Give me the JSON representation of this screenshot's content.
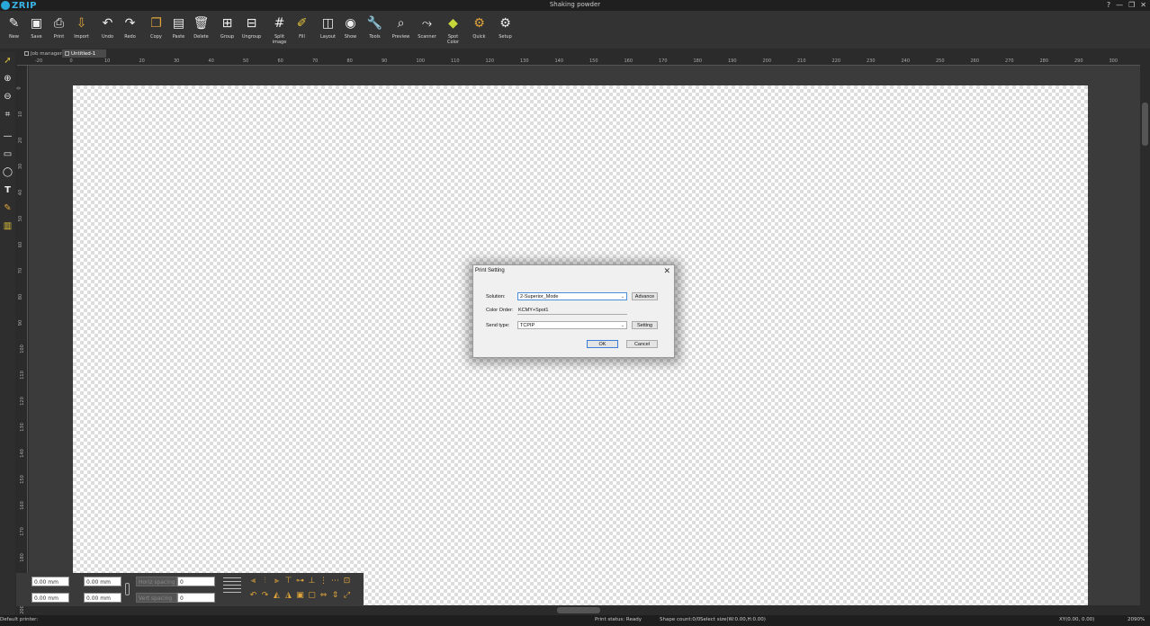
{
  "app": {
    "logo_text": "ZRIP",
    "window_title": "Shaking powder",
    "controls": [
      "?",
      "—",
      "❐",
      "✕"
    ]
  },
  "toolbar": {
    "buttons": [
      {
        "label": "New",
        "icon": "new-icon"
      },
      {
        "label": "Save",
        "icon": "save-icon"
      },
      {
        "label": "Print",
        "icon": "print-icon"
      },
      {
        "label": "Import",
        "icon": "import-icon"
      },
      {
        "label": "Undo",
        "icon": "undo-icon"
      },
      {
        "label": "Redo",
        "icon": "redo-icon"
      },
      {
        "label": "Copy",
        "icon": "copy-icon"
      },
      {
        "label": "Paste",
        "icon": "paste-icon"
      },
      {
        "label": "Delete",
        "icon": "delete-icon"
      },
      {
        "label": "Group",
        "icon": "group-icon"
      },
      {
        "label": "Ungroup",
        "icon": "ungroup-icon"
      },
      {
        "label": "Split\nimage",
        "icon": "split-image-icon"
      },
      {
        "label": "Fill",
        "icon": "fill-icon"
      },
      {
        "label": "Layout",
        "icon": "layout-icon"
      },
      {
        "label": "Show",
        "icon": "show-icon"
      },
      {
        "label": "Tools",
        "icon": "tools-icon"
      },
      {
        "label": "Preview",
        "icon": "preview-icon"
      },
      {
        "label": "Scanner",
        "icon": "scanner-icon"
      },
      {
        "label": "Spot\nColor",
        "icon": "spot-color-icon"
      },
      {
        "label": "Quick",
        "icon": "quick-icon"
      },
      {
        "label": "Setup",
        "icon": "setup-icon"
      }
    ]
  },
  "tabs": [
    {
      "label": "Job manager"
    },
    {
      "label": "Untitled-1"
    }
  ],
  "ruler": {
    "h_labels": [
      "-20",
      "0",
      "10",
      "20",
      "30",
      "40",
      "50",
      "60",
      "70",
      "80",
      "90",
      "100",
      "110",
      "120",
      "130",
      "140",
      "150",
      "160",
      "170",
      "180",
      "190",
      "200",
      "210",
      "220",
      "230",
      "240",
      "250",
      "260",
      "270",
      "280",
      "290",
      "300"
    ],
    "v_labels": [
      "0",
      "10",
      "20",
      "30",
      "40",
      "50",
      "60",
      "70",
      "80",
      "90",
      "100",
      "110",
      "120",
      "130",
      "140",
      "150",
      "160",
      "170",
      "180",
      "190",
      "200"
    ]
  },
  "props": {
    "x": "0.00 mm",
    "y": "0.00 mm",
    "w": "0.00 mm",
    "h": "0.00 mm",
    "field_a_label": "Horiz spacing",
    "field_a": "0",
    "field_b_label": "Vert spacing",
    "field_b": "0"
  },
  "status": {
    "printer": "Default printer:",
    "print_status": "Print status: Ready",
    "shape_count": "Shape count:0/0",
    "select_size": "Select size(W:0.00,H:0.00)",
    "xy": "XY(0.00, 0.00)",
    "zoom": "2090%"
  },
  "dialog": {
    "title": "Print Setting",
    "solution_label": "Solution:",
    "solution_value": "2-Superior_Mode",
    "advance_label": "Advance",
    "color_order_label": "Color Order:",
    "color_order_value": "KCMY+Spot1",
    "send_type_label": "Send type:",
    "send_type_value": "TCPIP",
    "setting_label": "Setting",
    "ok_label": "OK",
    "cancel_label": "Cancel"
  }
}
